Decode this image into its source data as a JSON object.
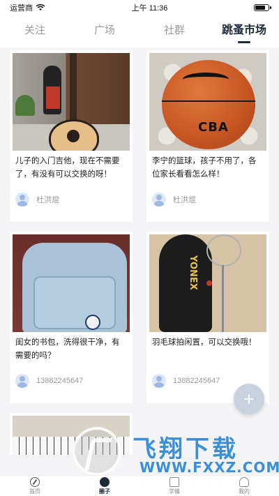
{
  "status_bar": {
    "carrier": "运营商",
    "time": "上午 11:36",
    "battery_level": 0.9
  },
  "top_tabs": [
    {
      "label": "关注",
      "active": false
    },
    {
      "label": "广场",
      "active": false
    },
    {
      "label": "社群",
      "active": false
    },
    {
      "label": "跳蚤市场",
      "active": true
    }
  ],
  "feed": [
    {
      "text": "儿子的入门吉他，现在不需要了，有没有可以交换的呀！",
      "author": "杜洪焜",
      "image": "guitar"
    },
    {
      "text": "李宁的篮球，孩子不用了，各位家长看看怎么样！",
      "author": "杜洪焜",
      "image": "basketball"
    },
    {
      "text": "闺女的书包，洗得很干净，有需要的吗？",
      "author": "13882245647",
      "image": "backpack"
    },
    {
      "text": "羽毛球拍闲置，可以交换哦！",
      "author": "13882245647",
      "image": "badminton-racket"
    }
  ],
  "image_labels": {
    "basketball_print": "CBA",
    "racket_cover_print": "YONEX"
  },
  "fab": {
    "symbol": "+"
  },
  "watermark": {
    "title": "飞翔下载",
    "url": "WWW.FXXZ.COM"
  },
  "bottom_nav": [
    {
      "label": "首页",
      "icon": "compass-icon",
      "active": false
    },
    {
      "label": "圈子",
      "icon": "circle-icon",
      "active": true
    },
    {
      "label": "学情",
      "icon": "book-icon",
      "active": false
    },
    {
      "label": "我的",
      "icon": "person-icon",
      "active": false
    }
  ],
  "colors": {
    "accent": "#1e2b3a",
    "inactive": "#9a9a9a",
    "background": "#f4f4f6",
    "watermark_blue": "#3a8fd6"
  }
}
